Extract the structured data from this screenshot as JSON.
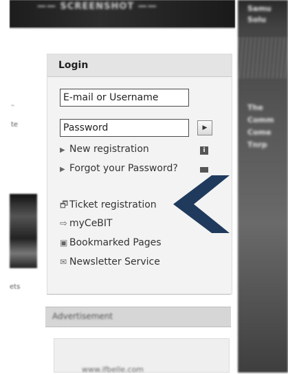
{
  "banner": {
    "text": "—— SCREENSHOT ——"
  },
  "right_column": {
    "lines": [
      "Samu",
      "Solu",
      "",
      "The",
      "Comm",
      "Come",
      "Tnrp"
    ]
  },
  "left_column": {
    "scrap1": "–",
    "scrap2": "te",
    "scrap3": "ets"
  },
  "login": {
    "title": "Login",
    "email_placeholder": "E-mail or Username",
    "password_placeholder": "Password",
    "submit_symbol": "▶",
    "new_registration": "New registration",
    "forgot_password": "Forgot your Password?",
    "info_symbol": "i",
    "ticket_registration": "Ticket registration",
    "mycebit": "myCeBIT",
    "bookmarked_pages": "Bookmarked Pages",
    "newsletter_service": "Newsletter Service"
  },
  "advertisement": {
    "title": "Advertisement",
    "url_text": "www.ifbelle.com"
  },
  "colors": {
    "accent_chevron": "#1f3a5c",
    "panel_bg": "#f3f3f3",
    "panel_head": "#e4e4e4"
  },
  "icons": {
    "link_arrow": "link-arrow-icon",
    "ticket": "ticket-icon",
    "mycebit": "arrow-right-icon",
    "bookmark": "bookmark-icon",
    "newsletter": "envelope-icon"
  }
}
